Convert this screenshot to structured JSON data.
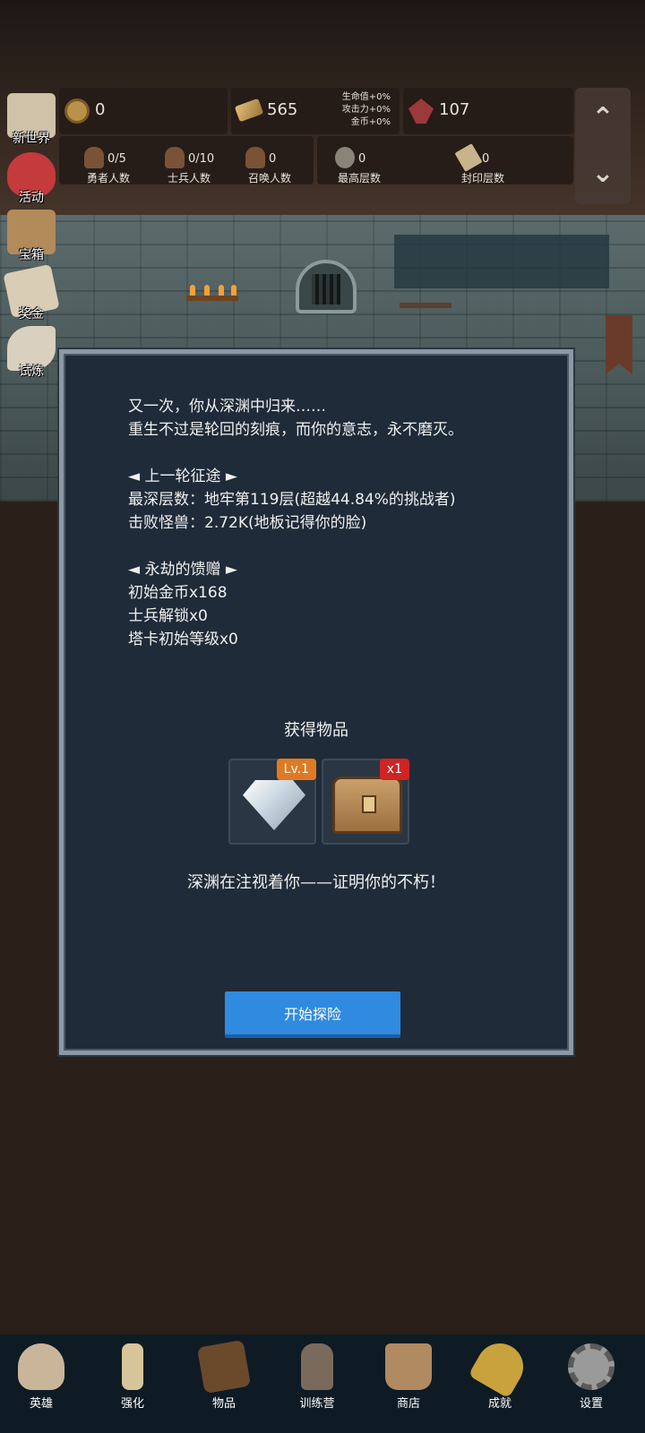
{
  "resources": {
    "coins": "0",
    "gold_bars": "565",
    "gems": "107",
    "bonuses": [
      "生命值+0%",
      "攻击力+0%",
      "金币+0%"
    ]
  },
  "stats": [
    {
      "value": "0/5",
      "label": "勇者人数"
    },
    {
      "value": "0/10",
      "label": "士兵人数"
    },
    {
      "value": "0",
      "label": "召唤人数"
    },
    {
      "value": "0",
      "label": "最高层数"
    },
    {
      "value": "0",
      "label": "封印层数"
    }
  ],
  "side_menu": [
    "新世界",
    "活动",
    "宝箱",
    "奖金",
    "试炼"
  ],
  "scroll": {
    "up": "⌃",
    "down": "⌄"
  },
  "modal": {
    "story": [
      "又一次，你从深渊中归来……",
      "重生不过是轮回的刻痕，而你的意志，永不磨灭。",
      "",
      "◄ 上一轮征途 ►",
      "最深层数：地牢第119层(超越44.84%的挑战者)",
      "击败怪兽：2.72K(地板记得你的脸)",
      "",
      "◄ 永劫的馈赠 ►",
      "初始金币x168",
      "士兵解锁x0",
      "塔卡初始等级x0"
    ],
    "obtain_title": "获得物品",
    "items": [
      {
        "icon": "diamond-icon",
        "tag": "Lv.1",
        "tag_color": "#e07a22"
      },
      {
        "icon": "treasure-chest-icon",
        "tag": "x1",
        "tag_color": "#d02323"
      }
    ],
    "abyss_text": "深渊在注视着你——证明你的不朽！",
    "start_button": "开始探险"
  },
  "bottom_nav": [
    {
      "label": "英雄",
      "icon": "skull-icon",
      "color": "#c9b59a"
    },
    {
      "label": "强化",
      "icon": "candle-icon",
      "color": "#d8c49a"
    },
    {
      "label": "物品",
      "icon": "book-icon",
      "color": "#6b4a2c"
    },
    {
      "label": "训练营",
      "icon": "lantern-icon",
      "color": "#7a6a5c"
    },
    {
      "label": "商店",
      "icon": "mug-icon",
      "color": "#b08a60"
    },
    {
      "label": "成就",
      "icon": "key-icon",
      "color": "#c8a23c"
    },
    {
      "label": "设置",
      "icon": "gear-icon",
      "color": "#9a9a9a"
    }
  ]
}
